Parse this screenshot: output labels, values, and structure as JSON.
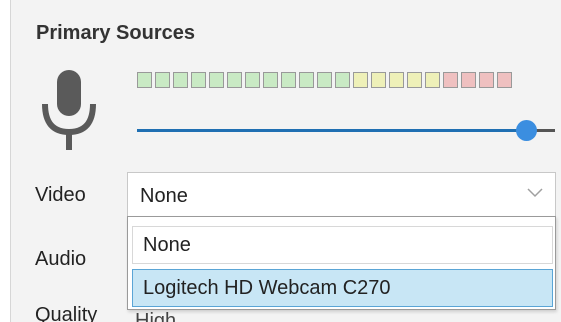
{
  "section": {
    "title": "Primary Sources"
  },
  "volume_meter": {
    "segments": [
      "#c9eac4",
      "#c9eac4",
      "#c9eac4",
      "#c9eac4",
      "#c9eac4",
      "#c9eac4",
      "#c9eac4",
      "#c9eac4",
      "#c9eac4",
      "#c9eac4",
      "#c9eac4",
      "#c9eac4",
      "#eef0b8",
      "#eef0b8",
      "#eef0b8",
      "#eef0b8",
      "#eef0b8",
      "#efc0c0",
      "#efc0c0",
      "#efc0c0",
      "#efc0c0"
    ]
  },
  "volume_slider": {
    "level": 0.93,
    "accent_color": "#1f6fb2"
  },
  "video": {
    "label": "Video",
    "selected": "None",
    "options": [
      "None",
      "Logitech HD Webcam C270"
    ],
    "highlighted_option": "Logitech HD Webcam C270"
  },
  "audio": {
    "label": "Audio"
  },
  "quality": {
    "label": "Quality",
    "value": "High"
  },
  "icons": {
    "microphone": "microphone-icon",
    "dropdown": "chevron-down-icon"
  }
}
